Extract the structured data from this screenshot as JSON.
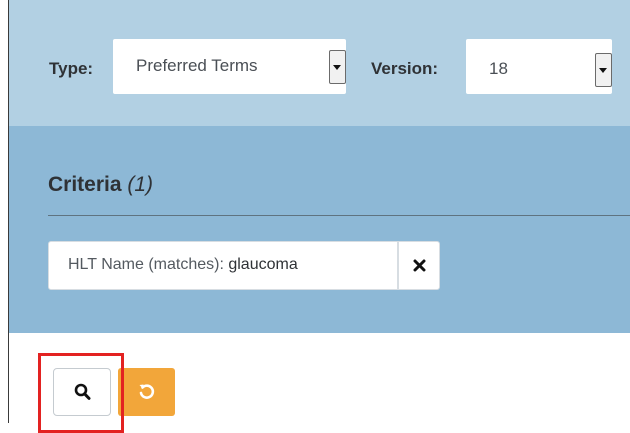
{
  "filters": {
    "type_label": "Type:",
    "type_value": "Preferred Terms",
    "version_label": "Version:",
    "version_value": "18"
  },
  "criteria": {
    "title": "Criteria",
    "count": "(1)",
    "items": [
      {
        "field": "HLT Name (matches):",
        "value": "glaucoma"
      }
    ]
  },
  "actions": {
    "search_icon": "search-icon",
    "reset_icon": "undo-icon",
    "reset_color": "#f2a63a"
  },
  "annotation": {
    "highlight_color": "#e32221"
  }
}
